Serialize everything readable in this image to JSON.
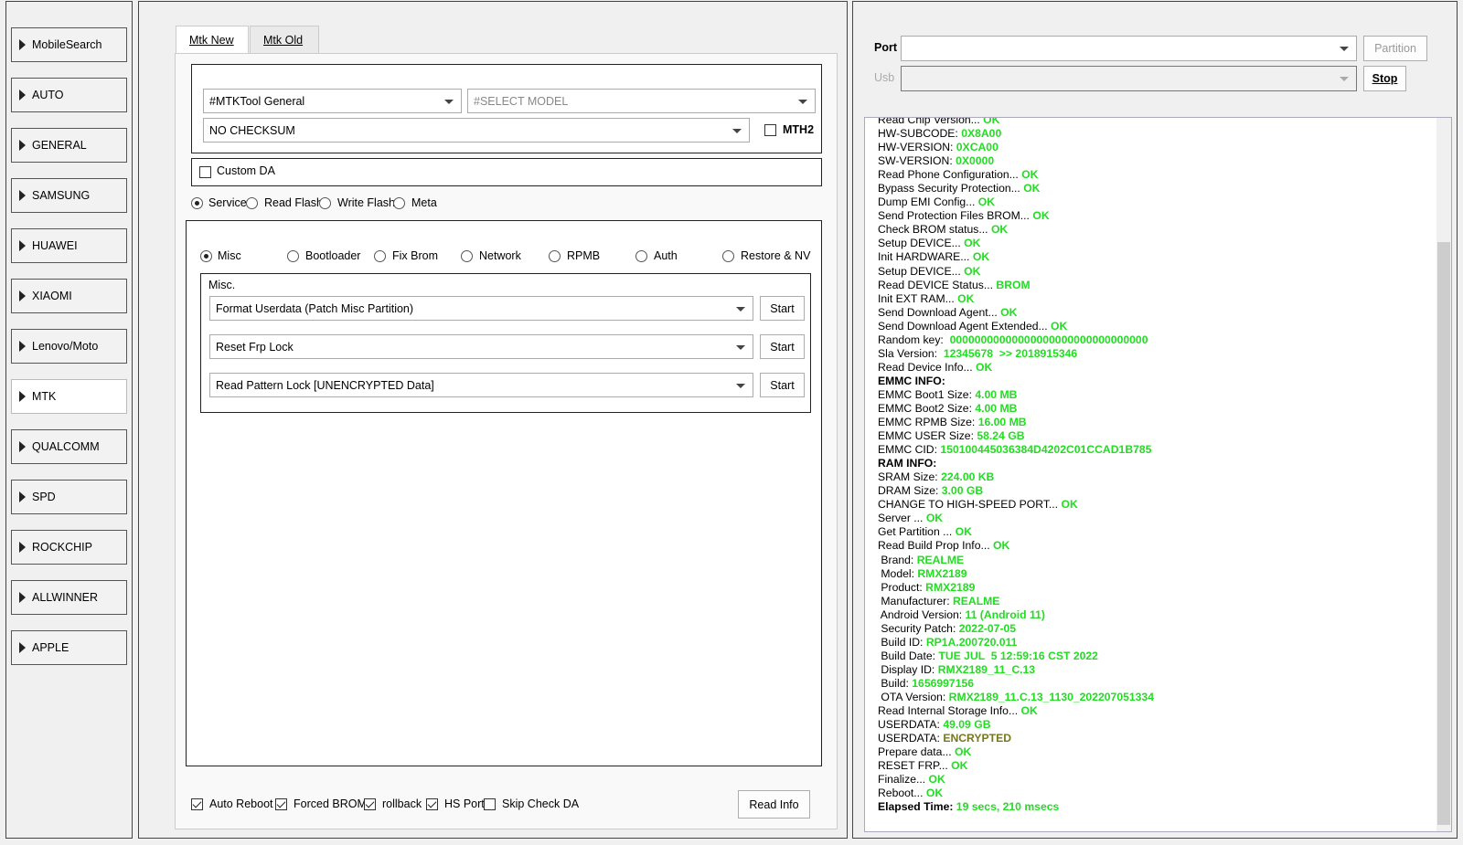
{
  "sidebar": {
    "items": [
      {
        "label": "MobileSearch"
      },
      {
        "label": "AUTO"
      },
      {
        "label": "GENERAL"
      },
      {
        "label": "SAMSUNG"
      },
      {
        "label": "HUAWEI"
      },
      {
        "label": "XIAOMI"
      },
      {
        "label": "Lenovo/Moto"
      },
      {
        "label": "MTK",
        "active": true
      },
      {
        "label": "QUALCOMM"
      },
      {
        "label": "SPD"
      },
      {
        "label": "ROCKCHIP"
      },
      {
        "label": "ALLWINNER"
      },
      {
        "label": "APPLE"
      }
    ]
  },
  "tabs": [
    {
      "label": "Mtk New",
      "active": true
    },
    {
      "label": "Mtk Old",
      "active": false
    }
  ],
  "top_group": {
    "tool_combo": "#MTKTool General",
    "model_combo": "#SELECT MODEL",
    "checksum_combo": "NO CHECKSUM",
    "mth2_label": "MTH2",
    "mth2_checked": false
  },
  "custom_da": {
    "label": "Custom DA",
    "checked": false
  },
  "mode_radios": [
    {
      "label": "Service",
      "selected": true
    },
    {
      "label": "Read Flash",
      "selected": false
    },
    {
      "label": "Write Flash",
      "selected": false
    },
    {
      "label": "Meta",
      "selected": false
    }
  ],
  "function_radios": [
    {
      "label": "Misc",
      "selected": true
    },
    {
      "label": "Bootloader",
      "selected": false
    },
    {
      "label": "Fix Brom",
      "selected": false
    },
    {
      "label": "Network",
      "selected": false
    },
    {
      "label": "RPMB",
      "selected": false
    },
    {
      "label": "Auth",
      "selected": false
    },
    {
      "label": "Restore & NV",
      "selected": false
    }
  ],
  "misc": {
    "title": "Misc.",
    "rows": [
      {
        "value": "Format Userdata (Patch Misc Partition)",
        "button": "Start"
      },
      {
        "value": "Reset Frp Lock",
        "button": "Start"
      },
      {
        "value": "Read Pattern Lock [UNENCRYPTED Data]",
        "button": "Start"
      }
    ]
  },
  "bottom_options": [
    {
      "label": "Auto Reboot",
      "checked": true
    },
    {
      "label": "Forced BROM",
      "checked": true
    },
    {
      "label": "rollback",
      "checked": true
    },
    {
      "label": "HS Port",
      "checked": true
    },
    {
      "label": "Skip Check DA",
      "checked": false
    }
  ],
  "read_info_button": "Read Info",
  "right": {
    "port_label": "Port",
    "port_value": "",
    "usb_label": "Usb",
    "usb_value": "",
    "partition_button": "Partition",
    "stop_button": "Stop"
  },
  "log": [
    {
      "t": "Read Chip Version... ",
      "v": "OK",
      "c": "ok"
    },
    {
      "t": "HW-SUBCODE: ",
      "v": "0X8A00",
      "c": "ok"
    },
    {
      "t": "HW-VERSION: ",
      "v": "0XCA00",
      "c": "ok"
    },
    {
      "t": "SW-VERSION: ",
      "v": "0X0000",
      "c": "ok"
    },
    {
      "t": "Read Phone Configuration... ",
      "v": "OK",
      "c": "ok"
    },
    {
      "t": "Bypass Security Protection... ",
      "v": "OK",
      "c": "ok"
    },
    {
      "t": "Dump EMI Config... ",
      "v": "OK",
      "c": "ok"
    },
    {
      "t": "Send Protection Files BROM... ",
      "v": "OK",
      "c": "ok"
    },
    {
      "t": "Check BROM status... ",
      "v": "OK",
      "c": "ok"
    },
    {
      "t": "Setup DEVICE... ",
      "v": "OK",
      "c": "ok"
    },
    {
      "t": "Init HARDWARE... ",
      "v": "OK",
      "c": "ok"
    },
    {
      "t": "Setup DEVICE... ",
      "v": "OK",
      "c": "ok"
    },
    {
      "t": "Read DEVICE Status... ",
      "v": "BROM",
      "c": "ok"
    },
    {
      "t": "Init EXT RAM... ",
      "v": "OK",
      "c": "ok"
    },
    {
      "t": "Send Download Agent... ",
      "v": "OK",
      "c": "ok"
    },
    {
      "t": "Send Download Agent Extended... ",
      "v": "OK",
      "c": "ok"
    },
    {
      "t": "Random key:  ",
      "v": "00000000000000000000000000000000",
      "c": "ok"
    },
    {
      "t": "Sla Version:  ",
      "v": "12345678  >> 2018915346",
      "c": "ok"
    },
    {
      "t": "Read Device Info... ",
      "v": "OK",
      "c": "ok"
    },
    {
      "t": "EMMC INFO:",
      "v": "",
      "c": "bold"
    },
    {
      "t": "EMMC Boot1 Size: ",
      "v": "4.00 MB",
      "c": "ok"
    },
    {
      "t": "EMMC Boot2 Size: ",
      "v": "4.00 MB",
      "c": "ok"
    },
    {
      "t": "EMMC RPMB Size: ",
      "v": "16.00 MB",
      "c": "ok"
    },
    {
      "t": "EMMC USER Size: ",
      "v": "58.24 GB",
      "c": "ok"
    },
    {
      "t": "EMMC CID: ",
      "v": "150100445036384D4202C01CCAD1B785",
      "c": "ok"
    },
    {
      "t": "RAM INFO:",
      "v": "",
      "c": "bold"
    },
    {
      "t": "SRAM Size: ",
      "v": "224.00 KB",
      "c": "ok"
    },
    {
      "t": "DRAM Size: ",
      "v": "3.00 GB",
      "c": "ok"
    },
    {
      "t": "CHANGE TO HIGH-SPEED PORT... ",
      "v": "OK",
      "c": "ok"
    },
    {
      "t": "Server ... ",
      "v": "OK",
      "c": "ok"
    },
    {
      "t": "Get Partition ... ",
      "v": "OK",
      "c": "ok"
    },
    {
      "t": "Read Build Prop Info... ",
      "v": "OK",
      "c": "ok"
    },
    {
      "t": " Brand: ",
      "v": "REALME",
      "c": "ok"
    },
    {
      "t": " Model: ",
      "v": "RMX2189",
      "c": "ok"
    },
    {
      "t": " Product: ",
      "v": "RMX2189",
      "c": "ok"
    },
    {
      "t": " Manufacturer: ",
      "v": "REALME",
      "c": "ok"
    },
    {
      "t": " Android Version: ",
      "v": "11 (Android 11)",
      "c": "ok"
    },
    {
      "t": " Security Patch: ",
      "v": "2022-07-05",
      "c": "ok"
    },
    {
      "t": " Build ID: ",
      "v": "RP1A.200720.011",
      "c": "ok"
    },
    {
      "t": " Build Date: ",
      "v": "TUE JUL  5 12:59:16 CST 2022",
      "c": "ok"
    },
    {
      "t": " Display ID: ",
      "v": "RMX2189_11_C.13",
      "c": "ok"
    },
    {
      "t": " Build: ",
      "v": "1656997156",
      "c": "ok"
    },
    {
      "t": " OTA Version: ",
      "v": "RMX2189_11.C.13_1130_202207051334",
      "c": "ok"
    },
    {
      "t": "Read Internal Storage Info... ",
      "v": "OK",
      "c": "ok"
    },
    {
      "t": "USERDATA: ",
      "v": "49.09 GB",
      "c": "ok"
    },
    {
      "t": "USERDATA: ",
      "v": "ENCRYPTED",
      "c": "warn"
    },
    {
      "t": "Prepare data... ",
      "v": "OK",
      "c": "ok"
    },
    {
      "t": "RESET FRP... ",
      "v": "OK",
      "c": "ok"
    },
    {
      "t": "Finalize... ",
      "v": "OK",
      "c": "ok"
    },
    {
      "t": "Reboot... ",
      "v": "OK",
      "c": "ok"
    },
    {
      "t": "Elapsed Time: ",
      "v": "19 secs, 210 msecs",
      "c": "elapsed"
    }
  ]
}
